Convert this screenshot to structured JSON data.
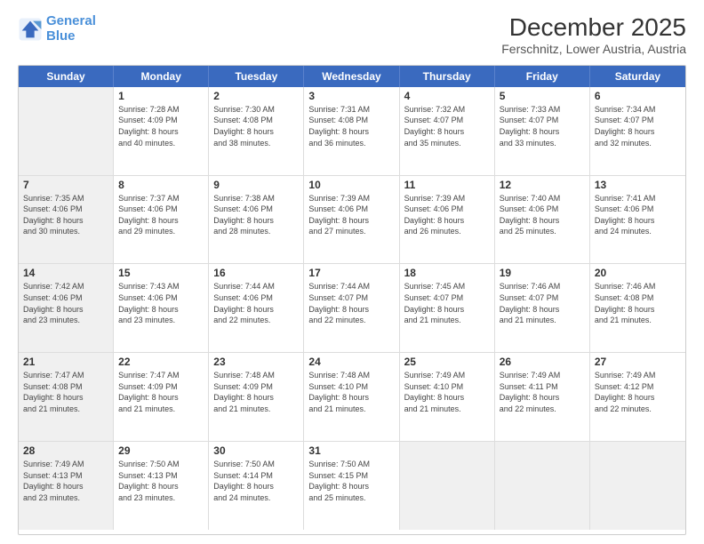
{
  "header": {
    "logo_line1": "General",
    "logo_line2": "Blue",
    "title": "December 2025",
    "subtitle": "Ferschnitz, Lower Austria, Austria"
  },
  "weekdays": [
    "Sunday",
    "Monday",
    "Tuesday",
    "Wednesday",
    "Thursday",
    "Friday",
    "Saturday"
  ],
  "rows": [
    [
      {
        "day": "",
        "text": "",
        "shaded": true
      },
      {
        "day": "1",
        "text": "Sunrise: 7:28 AM\nSunset: 4:09 PM\nDaylight: 8 hours\nand 40 minutes.",
        "shaded": false
      },
      {
        "day": "2",
        "text": "Sunrise: 7:30 AM\nSunset: 4:08 PM\nDaylight: 8 hours\nand 38 minutes.",
        "shaded": false
      },
      {
        "day": "3",
        "text": "Sunrise: 7:31 AM\nSunset: 4:08 PM\nDaylight: 8 hours\nand 36 minutes.",
        "shaded": false
      },
      {
        "day": "4",
        "text": "Sunrise: 7:32 AM\nSunset: 4:07 PM\nDaylight: 8 hours\nand 35 minutes.",
        "shaded": false
      },
      {
        "day": "5",
        "text": "Sunrise: 7:33 AM\nSunset: 4:07 PM\nDaylight: 8 hours\nand 33 minutes.",
        "shaded": false
      },
      {
        "day": "6",
        "text": "Sunrise: 7:34 AM\nSunset: 4:07 PM\nDaylight: 8 hours\nand 32 minutes.",
        "shaded": false
      }
    ],
    [
      {
        "day": "7",
        "text": "Sunrise: 7:35 AM\nSunset: 4:06 PM\nDaylight: 8 hours\nand 30 minutes.",
        "shaded": true
      },
      {
        "day": "8",
        "text": "Sunrise: 7:37 AM\nSunset: 4:06 PM\nDaylight: 8 hours\nand 29 minutes.",
        "shaded": false
      },
      {
        "day": "9",
        "text": "Sunrise: 7:38 AM\nSunset: 4:06 PM\nDaylight: 8 hours\nand 28 minutes.",
        "shaded": false
      },
      {
        "day": "10",
        "text": "Sunrise: 7:39 AM\nSunset: 4:06 PM\nDaylight: 8 hours\nand 27 minutes.",
        "shaded": false
      },
      {
        "day": "11",
        "text": "Sunrise: 7:39 AM\nSunset: 4:06 PM\nDaylight: 8 hours\nand 26 minutes.",
        "shaded": false
      },
      {
        "day": "12",
        "text": "Sunrise: 7:40 AM\nSunset: 4:06 PM\nDaylight: 8 hours\nand 25 minutes.",
        "shaded": false
      },
      {
        "day": "13",
        "text": "Sunrise: 7:41 AM\nSunset: 4:06 PM\nDaylight: 8 hours\nand 24 minutes.",
        "shaded": false
      }
    ],
    [
      {
        "day": "14",
        "text": "Sunrise: 7:42 AM\nSunset: 4:06 PM\nDaylight: 8 hours\nand 23 minutes.",
        "shaded": true
      },
      {
        "day": "15",
        "text": "Sunrise: 7:43 AM\nSunset: 4:06 PM\nDaylight: 8 hours\nand 23 minutes.",
        "shaded": false
      },
      {
        "day": "16",
        "text": "Sunrise: 7:44 AM\nSunset: 4:06 PM\nDaylight: 8 hours\nand 22 minutes.",
        "shaded": false
      },
      {
        "day": "17",
        "text": "Sunrise: 7:44 AM\nSunset: 4:07 PM\nDaylight: 8 hours\nand 22 minutes.",
        "shaded": false
      },
      {
        "day": "18",
        "text": "Sunrise: 7:45 AM\nSunset: 4:07 PM\nDaylight: 8 hours\nand 21 minutes.",
        "shaded": false
      },
      {
        "day": "19",
        "text": "Sunrise: 7:46 AM\nSunset: 4:07 PM\nDaylight: 8 hours\nand 21 minutes.",
        "shaded": false
      },
      {
        "day": "20",
        "text": "Sunrise: 7:46 AM\nSunset: 4:08 PM\nDaylight: 8 hours\nand 21 minutes.",
        "shaded": false
      }
    ],
    [
      {
        "day": "21",
        "text": "Sunrise: 7:47 AM\nSunset: 4:08 PM\nDaylight: 8 hours\nand 21 minutes.",
        "shaded": true
      },
      {
        "day": "22",
        "text": "Sunrise: 7:47 AM\nSunset: 4:09 PM\nDaylight: 8 hours\nand 21 minutes.",
        "shaded": false
      },
      {
        "day": "23",
        "text": "Sunrise: 7:48 AM\nSunset: 4:09 PM\nDaylight: 8 hours\nand 21 minutes.",
        "shaded": false
      },
      {
        "day": "24",
        "text": "Sunrise: 7:48 AM\nSunset: 4:10 PM\nDaylight: 8 hours\nand 21 minutes.",
        "shaded": false
      },
      {
        "day": "25",
        "text": "Sunrise: 7:49 AM\nSunset: 4:10 PM\nDaylight: 8 hours\nand 21 minutes.",
        "shaded": false
      },
      {
        "day": "26",
        "text": "Sunrise: 7:49 AM\nSunset: 4:11 PM\nDaylight: 8 hours\nand 22 minutes.",
        "shaded": false
      },
      {
        "day": "27",
        "text": "Sunrise: 7:49 AM\nSunset: 4:12 PM\nDaylight: 8 hours\nand 22 minutes.",
        "shaded": false
      }
    ],
    [
      {
        "day": "28",
        "text": "Sunrise: 7:49 AM\nSunset: 4:13 PM\nDaylight: 8 hours\nand 23 minutes.",
        "shaded": true
      },
      {
        "day": "29",
        "text": "Sunrise: 7:50 AM\nSunset: 4:13 PM\nDaylight: 8 hours\nand 23 minutes.",
        "shaded": false
      },
      {
        "day": "30",
        "text": "Sunrise: 7:50 AM\nSunset: 4:14 PM\nDaylight: 8 hours\nand 24 minutes.",
        "shaded": false
      },
      {
        "day": "31",
        "text": "Sunrise: 7:50 AM\nSunset: 4:15 PM\nDaylight: 8 hours\nand 25 minutes.",
        "shaded": false
      },
      {
        "day": "",
        "text": "",
        "shaded": true
      },
      {
        "day": "",
        "text": "",
        "shaded": true
      },
      {
        "day": "",
        "text": "",
        "shaded": true
      }
    ]
  ]
}
